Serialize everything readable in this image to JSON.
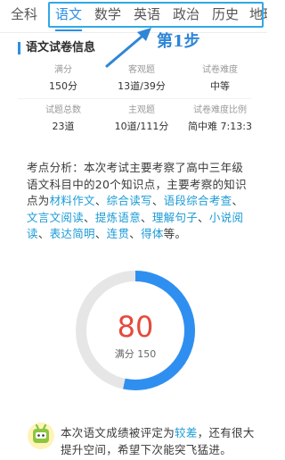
{
  "subject_tabs": [
    {
      "label": "全科",
      "active": false
    },
    {
      "label": "语文",
      "active": true
    },
    {
      "label": "数学",
      "active": false
    },
    {
      "label": "英语",
      "active": false
    },
    {
      "label": "政治",
      "active": false
    },
    {
      "label": "历史",
      "active": false
    },
    {
      "label": "地理",
      "active": false
    }
  ],
  "annotation": {
    "step_label": "第1步",
    "color": "#2f86d6"
  },
  "exam_info": {
    "title": "语文试卷信息",
    "rows": [
      [
        {
          "label": "满分",
          "value": "150分"
        },
        {
          "label": "客观题",
          "value": "13道/39分"
        },
        {
          "label": "试卷难度",
          "value": "中等"
        }
      ],
      [
        {
          "label": "试题总数",
          "value": "23道"
        },
        {
          "label": "主观题",
          "value": "10道/111分"
        },
        {
          "label": "试卷难度比例",
          "value": "简中难 7:13:3"
        }
      ]
    ]
  },
  "analysis": {
    "prefix": "考点分析：本次考试主要考察了高中三年级语文科目中的20个知识点，主要考察的知识点为",
    "kp1": "材料作文",
    "kp2": "综合读写",
    "kp3": "语段综合考查",
    "kp4": "文言文阅读",
    "kp5": "提炼语意",
    "kp6": "理解句子",
    "kp7": "小说阅读",
    "kp8": "表达简明",
    "kp9": "连贯",
    "kp10": "得体",
    "sep": "、",
    "suffix": "等。"
  },
  "score": {
    "value": "80",
    "full_label": "满分 150",
    "progress_fraction": 0.533,
    "progress_color": "#2f8ff0",
    "track_color": "#e6e6e6",
    "value_color": "#e64a3a"
  },
  "comment": {
    "icon": "robot-icon",
    "prefix": "本次语文成绩被评定为",
    "level": "较差",
    "suffix": "，还有很大提升空间，希望下次能突飞猛进。"
  },
  "colors": {
    "accent": "#2d8fe3",
    "knowledge_point": "#1b9bd6"
  }
}
